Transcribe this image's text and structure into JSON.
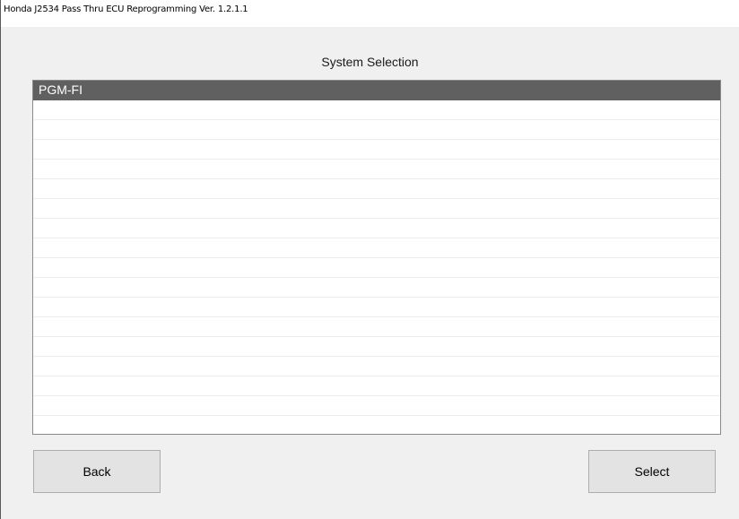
{
  "window": {
    "title": "Honda J2534 Pass Thru ECU Reprogramming Ver. 1.2.1.1"
  },
  "main": {
    "heading": "System Selection",
    "list": {
      "items": [
        "PGM-FI",
        "",
        "",
        "",
        "",
        "",
        "",
        "",
        "",
        "",
        "",
        "",
        "",
        "",
        "",
        "",
        "",
        ""
      ],
      "selected_index": 0
    }
  },
  "buttons": {
    "back_label": "Back",
    "select_label": "Select"
  },
  "colors": {
    "selection_bg": "#606060",
    "window_bg": "#f0f0f0",
    "button_bg": "#e3e3e3"
  }
}
